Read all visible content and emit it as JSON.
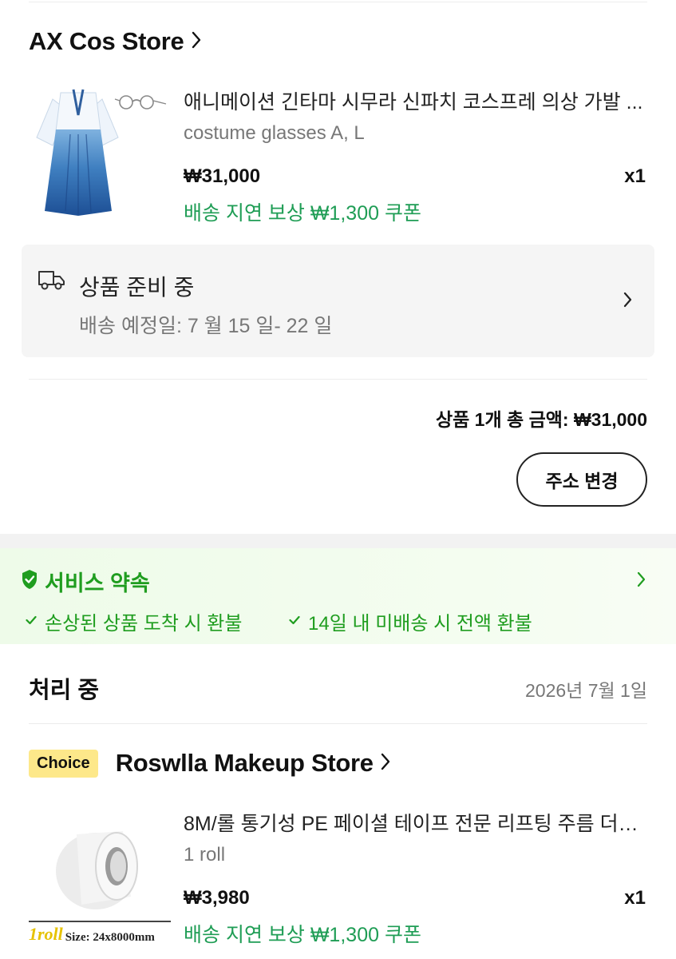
{
  "order1": {
    "store_name": "AX Cos Store",
    "product": {
      "title": "애니메이션 긴타마 시무라 신파치 코스프레 의상 가발 ...",
      "variant": "costume glasses A, L",
      "price": "₩31,000",
      "quantity": "x1",
      "coupon": "배송 지연 보상 ₩1,300 쿠폰"
    },
    "shipping": {
      "icon": "truck-icon",
      "status": "상품 준비 중",
      "eta": "배송 예정일: 7 월 15 일- 22 일"
    },
    "total": "상품 1개 총 금액: ₩31,000",
    "change_address_label": "주소 변경"
  },
  "service_promise": {
    "title": "서비스 약속",
    "items": [
      "손상된 상품 도착 시 환불",
      "14일 내 미배송 시 전액 환불"
    ],
    "accent_color": "#1f9d1f"
  },
  "processing": {
    "title": "처리 중",
    "date": "2026년 7월 1일"
  },
  "order2": {
    "badge": "Choice",
    "store_name": "Roswlla Makeup Store",
    "product": {
      "title": "8M/롤 통기성 PE 페이셜 테이프 전문 리프팅 주름 더블...",
      "variant": "1 roll",
      "price": "₩3,980",
      "quantity": "x1",
      "coupon": "배송 지연 보상 ₩1,300 쿠폰",
      "image_caption_left": "1roll",
      "image_caption_right": "Size: 24x8000mm"
    }
  }
}
